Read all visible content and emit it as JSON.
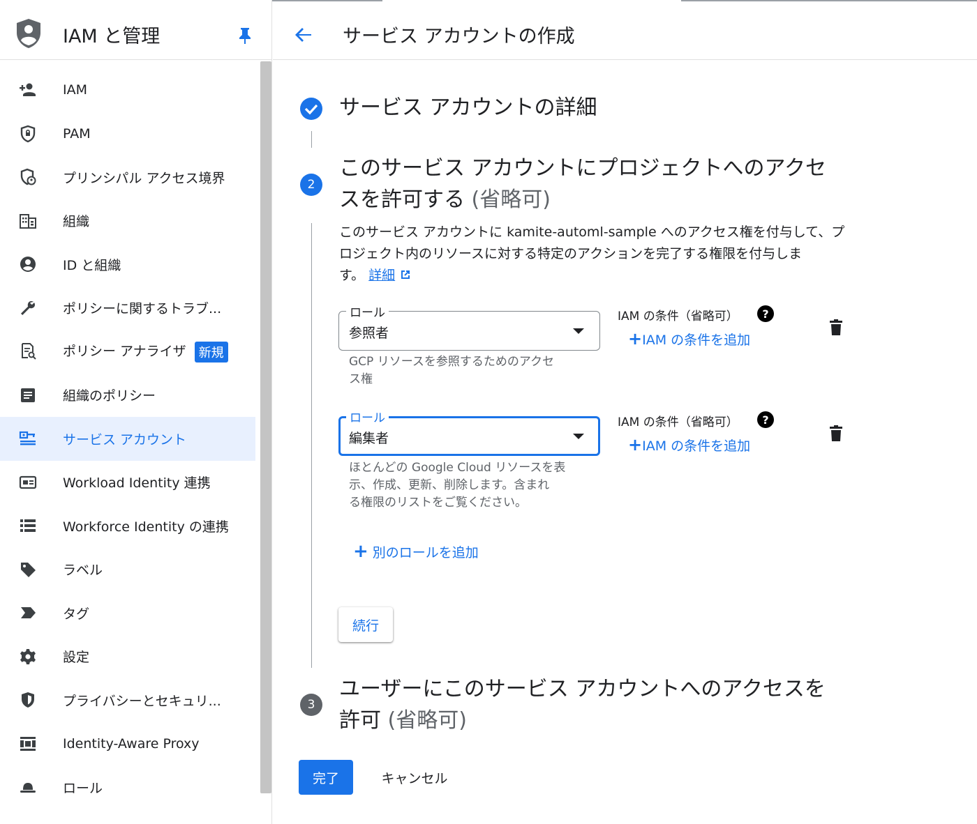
{
  "sidebar": {
    "title": "IAM と管理",
    "items": [
      {
        "label": "IAM",
        "icon": "person-add-icon"
      },
      {
        "label": "PAM",
        "icon": "shield-lock-icon"
      },
      {
        "label": "プリンシパル アクセス境界",
        "icon": "shield-person-icon"
      },
      {
        "label": "組織",
        "icon": "business-icon"
      },
      {
        "label": "ID と組織",
        "icon": "account-circle-icon"
      },
      {
        "label": "ポリシーに関するトラブ...",
        "icon": "wrench-icon"
      },
      {
        "label": "ポリシー アナライザ",
        "icon": "policy-analyzer-icon",
        "badge": "新規"
      },
      {
        "label": "組織のポリシー",
        "icon": "article-icon"
      },
      {
        "label": "サービス アカウント",
        "icon": "service-account-icon",
        "active": true
      },
      {
        "label": "Workload Identity 連携",
        "icon": "id-card-icon"
      },
      {
        "label": "Workforce Identity の連携",
        "icon": "list-icon"
      },
      {
        "label": "ラベル",
        "icon": "label-tag-icon"
      },
      {
        "label": "タグ",
        "icon": "tag-arrow-icon"
      },
      {
        "label": "設定",
        "icon": "gear-icon"
      },
      {
        "label": "プライバシーとセキュリ...",
        "icon": "security-shield-icon"
      },
      {
        "label": "Identity-Aware Proxy",
        "icon": "proxy-icon"
      },
      {
        "label": "ロール",
        "icon": "hat-icon"
      }
    ]
  },
  "header": {
    "title": "サービス アカウントの作成"
  },
  "steps": {
    "step1": {
      "title": "サービス アカウントの詳細"
    },
    "step2": {
      "number": "2",
      "title_line1": "このサービス アカウントにプロジェクトへのアクセ",
      "title_line2": "スを許可する",
      "optional": "(省略可)",
      "description_line1": "このサービス アカウントに kamite-automl-sample へのアクセス権を付与して、プ",
      "description_line2": "ロジェクト内のリソースに対する特定のアクションを完了する権限を付与しま",
      "description_line3": "す。",
      "details_link": "詳細"
    },
    "step3": {
      "number": "3",
      "title_line1": "ユーザーにこのサービス アカウントへのアクセスを",
      "title_line2": "許可",
      "optional": "(省略可)"
    }
  },
  "roles": [
    {
      "legend": "ロール",
      "value": "参照者",
      "help_line1": "GCP リソースを参照するためのアクセ",
      "help_line2": "ス権",
      "condition_label": "IAM の条件（省略可）",
      "condition_add": "IAM の条件を追加"
    },
    {
      "legend": "ロール",
      "value": "編集者",
      "help_line1": "ほとんどの Google Cloud リソースを表",
      "help_line2": "示、作成、更新、削除します。含まれ",
      "help_line3": "る権限のリストをご覧ください。",
      "condition_label": "IAM の条件（省略可）",
      "condition_add": "IAM の条件を追加"
    }
  ],
  "add_role": "別のロールを追加",
  "buttons": {
    "continue": "続行",
    "done": "完了",
    "cancel": "キャンセル"
  },
  "colors": {
    "accent": "#1a73e8",
    "active_bg": "#e8f0fe",
    "step3_icon": "#5f6368"
  }
}
